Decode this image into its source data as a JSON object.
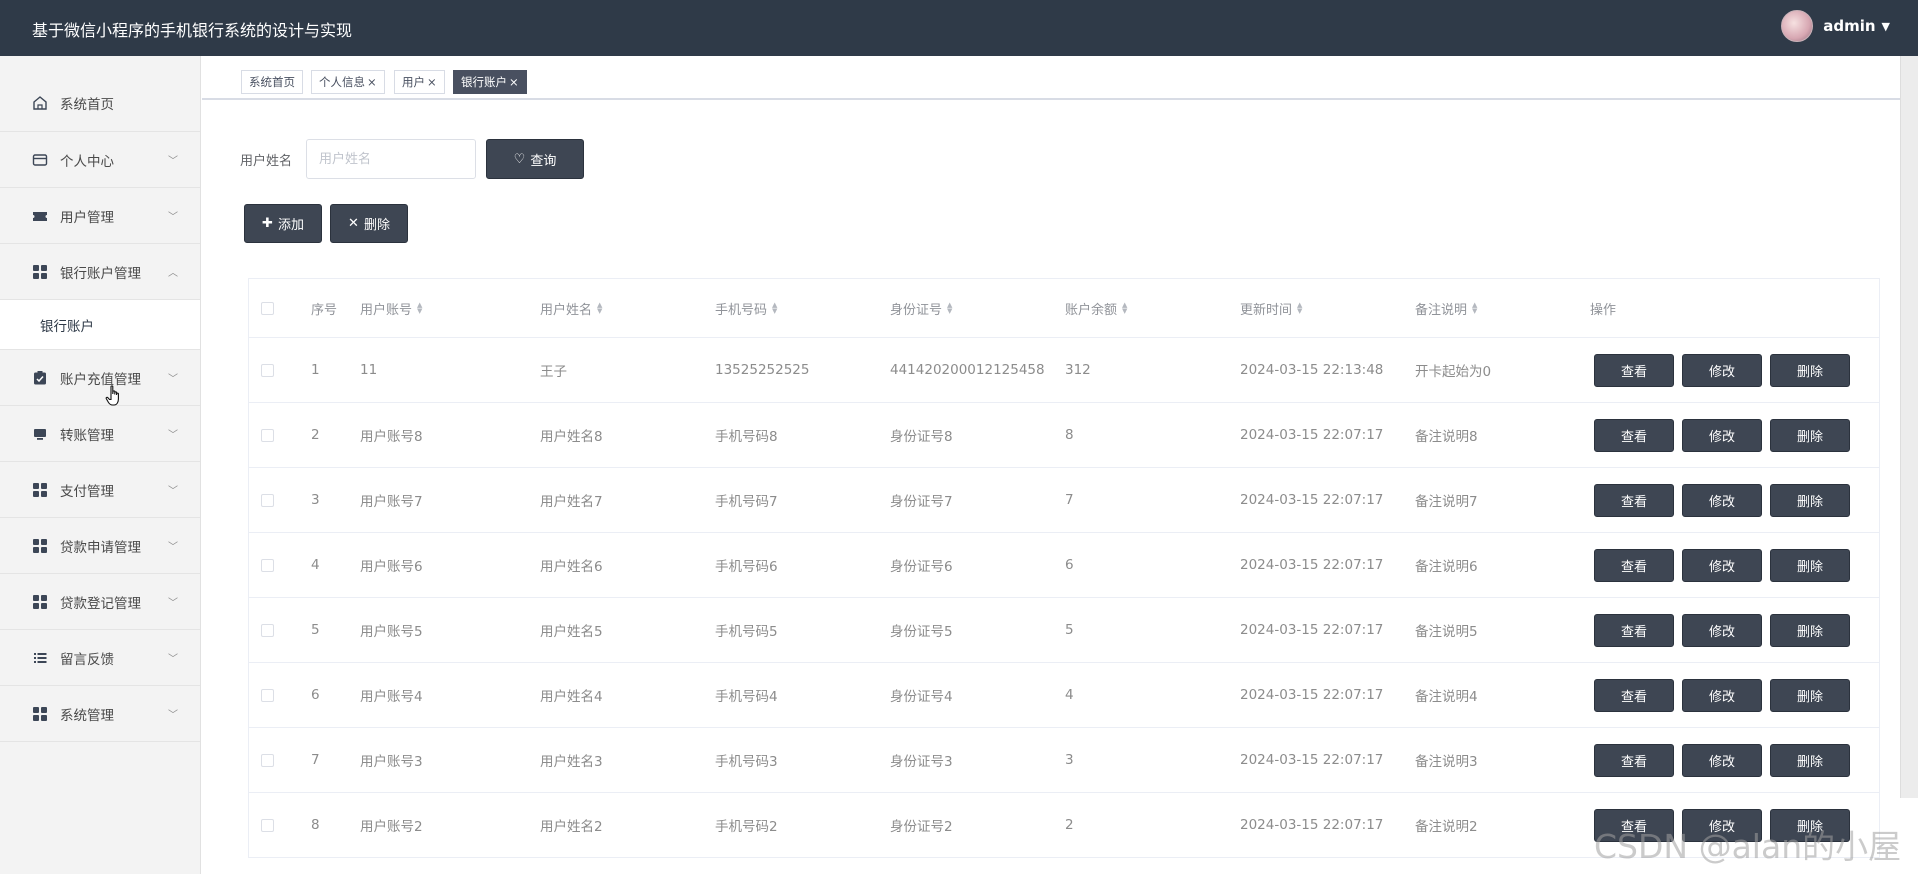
{
  "app": {
    "title": "基于微信小程序的手机银行系统的设计与实现",
    "username": "admin"
  },
  "sidebar": {
    "items": [
      {
        "label": "系统首页",
        "icon": "home-icon",
        "expandable": false
      },
      {
        "label": "个人中心",
        "icon": "card-icon",
        "expandable": true
      },
      {
        "label": "用户管理",
        "icon": "ticket-icon",
        "expandable": true
      },
      {
        "label": "银行账户管理",
        "icon": "grid-icon",
        "expandable": true,
        "expanded": true
      },
      {
        "label": "账户充值管理",
        "icon": "clipboard-icon",
        "expandable": true
      },
      {
        "label": "转账管理",
        "icon": "monitor-icon",
        "expandable": true
      },
      {
        "label": "支付管理",
        "icon": "grid-icon",
        "expandable": true
      },
      {
        "label": "贷款申请管理",
        "icon": "grid-icon",
        "expandable": true
      },
      {
        "label": "贷款登记管理",
        "icon": "grid-icon",
        "expandable": true
      },
      {
        "label": "留言反馈",
        "icon": "list-icon",
        "expandable": true
      },
      {
        "label": "系统管理",
        "icon": "grid-icon",
        "expandable": true
      }
    ],
    "sub_item": "银行账户"
  },
  "tabs": [
    {
      "label": "系统首页",
      "closable": false,
      "active": false
    },
    {
      "label": "个人信息",
      "closable": true,
      "active": false
    },
    {
      "label": "用户",
      "closable": true,
      "active": false
    },
    {
      "label": "银行账户",
      "closable": true,
      "active": true
    }
  ],
  "search": {
    "label": "用户姓名",
    "placeholder": "用户姓名",
    "value": "",
    "button": "查询"
  },
  "toolbar": {
    "add_label": "添加",
    "delete_label": "删除"
  },
  "table": {
    "headers": [
      "序号",
      "用户账号",
      "用户姓名",
      "手机号码",
      "身份证号",
      "账户余额",
      "更新时间",
      "备注说明",
      "操作"
    ],
    "actions": {
      "view": "查看",
      "edit": "修改",
      "delete": "删除"
    },
    "rows": [
      [
        "1",
        "11",
        "王子",
        "13525252525",
        "441420200012125458",
        "312",
        "2024-03-15 22:13:48",
        "开卡起始为0"
      ],
      [
        "2",
        "用户账号8",
        "用户姓名8",
        "手机号码8",
        "身份证号8",
        "8",
        "2024-03-15 22:07:17",
        "备注说明8"
      ],
      [
        "3",
        "用户账号7",
        "用户姓名7",
        "手机号码7",
        "身份证号7",
        "7",
        "2024-03-15 22:07:17",
        "备注说明7"
      ],
      [
        "4",
        "用户账号6",
        "用户姓名6",
        "手机号码6",
        "身份证号6",
        "6",
        "2024-03-15 22:07:17",
        "备注说明6"
      ],
      [
        "5",
        "用户账号5",
        "用户姓名5",
        "手机号码5",
        "身份证号5",
        "5",
        "2024-03-15 22:07:17",
        "备注说明5"
      ],
      [
        "6",
        "用户账号4",
        "用户姓名4",
        "手机号码4",
        "身份证号4",
        "4",
        "2024-03-15 22:07:17",
        "备注说明4"
      ],
      [
        "7",
        "用户账号3",
        "用户姓名3",
        "手机号码3",
        "身份证号3",
        "3",
        "2024-03-15 22:07:17",
        "备注说明3"
      ],
      [
        "8",
        "用户账号2",
        "用户姓名2",
        "手机号码2",
        "身份证号2",
        "2",
        "2024-03-15 22:07:17",
        "备注说明2"
      ]
    ]
  },
  "watermark": "CSDN @alan的小屋",
  "colors": {
    "header_bg": "#2f3a48",
    "button_bg": "#3e4653",
    "active_tab_bg": "#495060"
  }
}
